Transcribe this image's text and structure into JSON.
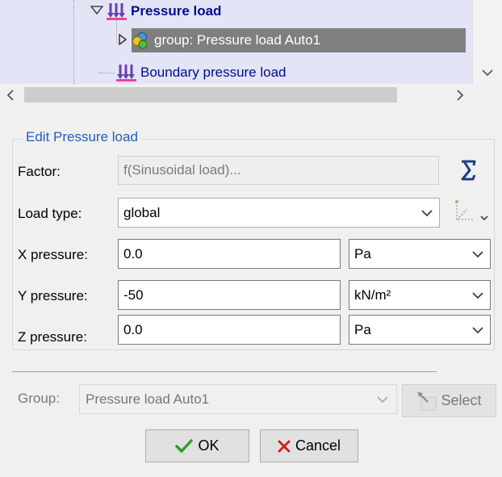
{
  "tree": {
    "items": [
      {
        "label": "Pressure load",
        "icon": "pressure-load-icon",
        "expanded": true
      },
      {
        "label": "group: Pressure load Auto1",
        "icon": "group-icon",
        "selected": true
      },
      {
        "label": "Boundary pressure load",
        "icon": "pressure-load-icon"
      }
    ]
  },
  "edit_panel": {
    "title": "Edit Pressure load",
    "factor": {
      "label": "Factor:",
      "value": "f(Sinusoidal load)..."
    },
    "load_type": {
      "label": "Load type:",
      "value": "global"
    },
    "x_pressure": {
      "label": "X pressure:",
      "value": "0.0",
      "unit": "Pa"
    },
    "y_pressure": {
      "label": "Y pressure:",
      "value": "-50",
      "unit": "kN/m²"
    },
    "z_pressure": {
      "label": "Z pressure:",
      "value": "0.0",
      "unit": "Pa"
    }
  },
  "group": {
    "label": "Group:",
    "value": "Pressure load Auto1",
    "select_label": "Select"
  },
  "buttons": {
    "ok": "OK",
    "cancel": "Cancel"
  },
  "colors": {
    "accent": "#1f5fbf",
    "tree_bg": "#e4e4f7",
    "tree_text": "#000d90",
    "selected_bg": "#7f7f7f",
    "ok_check": "#2e9e2e",
    "cancel_x": "#d02020"
  }
}
